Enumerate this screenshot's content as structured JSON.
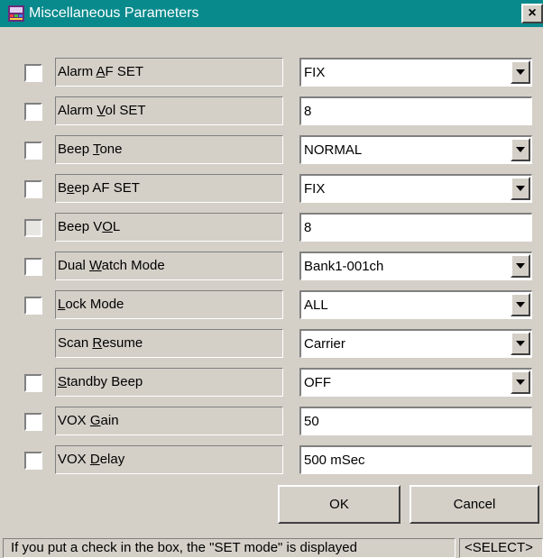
{
  "window": {
    "title": "Miscellaneous Parameters",
    "close_label": "×"
  },
  "rows": [
    {
      "pre": "Alarm ",
      "key": "A",
      "post": "F SET",
      "value": "FIX"
    },
    {
      "pre": "Alarm ",
      "key": "V",
      "post": "ol SET",
      "value": "8"
    },
    {
      "pre": "Beep ",
      "key": "T",
      "post": "one",
      "value": "NORMAL"
    },
    {
      "pre": "B",
      "key": "e",
      "post": "ep AF SET",
      "value": "FIX"
    },
    {
      "pre": "Beep V",
      "key": "O",
      "post": "L",
      "value": "8"
    },
    {
      "pre": "Dual ",
      "key": "W",
      "post": "atch Mode",
      "value": "Bank1-001ch"
    },
    {
      "pre": "",
      "key": "L",
      "post": "ock Mode",
      "value": "ALL"
    },
    {
      "pre": "Scan ",
      "key": "R",
      "post": "esume",
      "value": "Carrier"
    },
    {
      "pre": "",
      "key": "S",
      "post": "tandby Beep",
      "value": "OFF"
    },
    {
      "pre": "VOX ",
      "key": "G",
      "post": "ain",
      "value": "50"
    },
    {
      "pre": "VOX ",
      "key": "D",
      "post": "elay",
      "value": "500 mSec"
    }
  ],
  "buttons": {
    "ok": "OK",
    "cancel": "Cancel"
  },
  "status": {
    "message": "If you put a check in the box, the \"SET mode\" is displayed",
    "mode": "<SELECT>"
  }
}
